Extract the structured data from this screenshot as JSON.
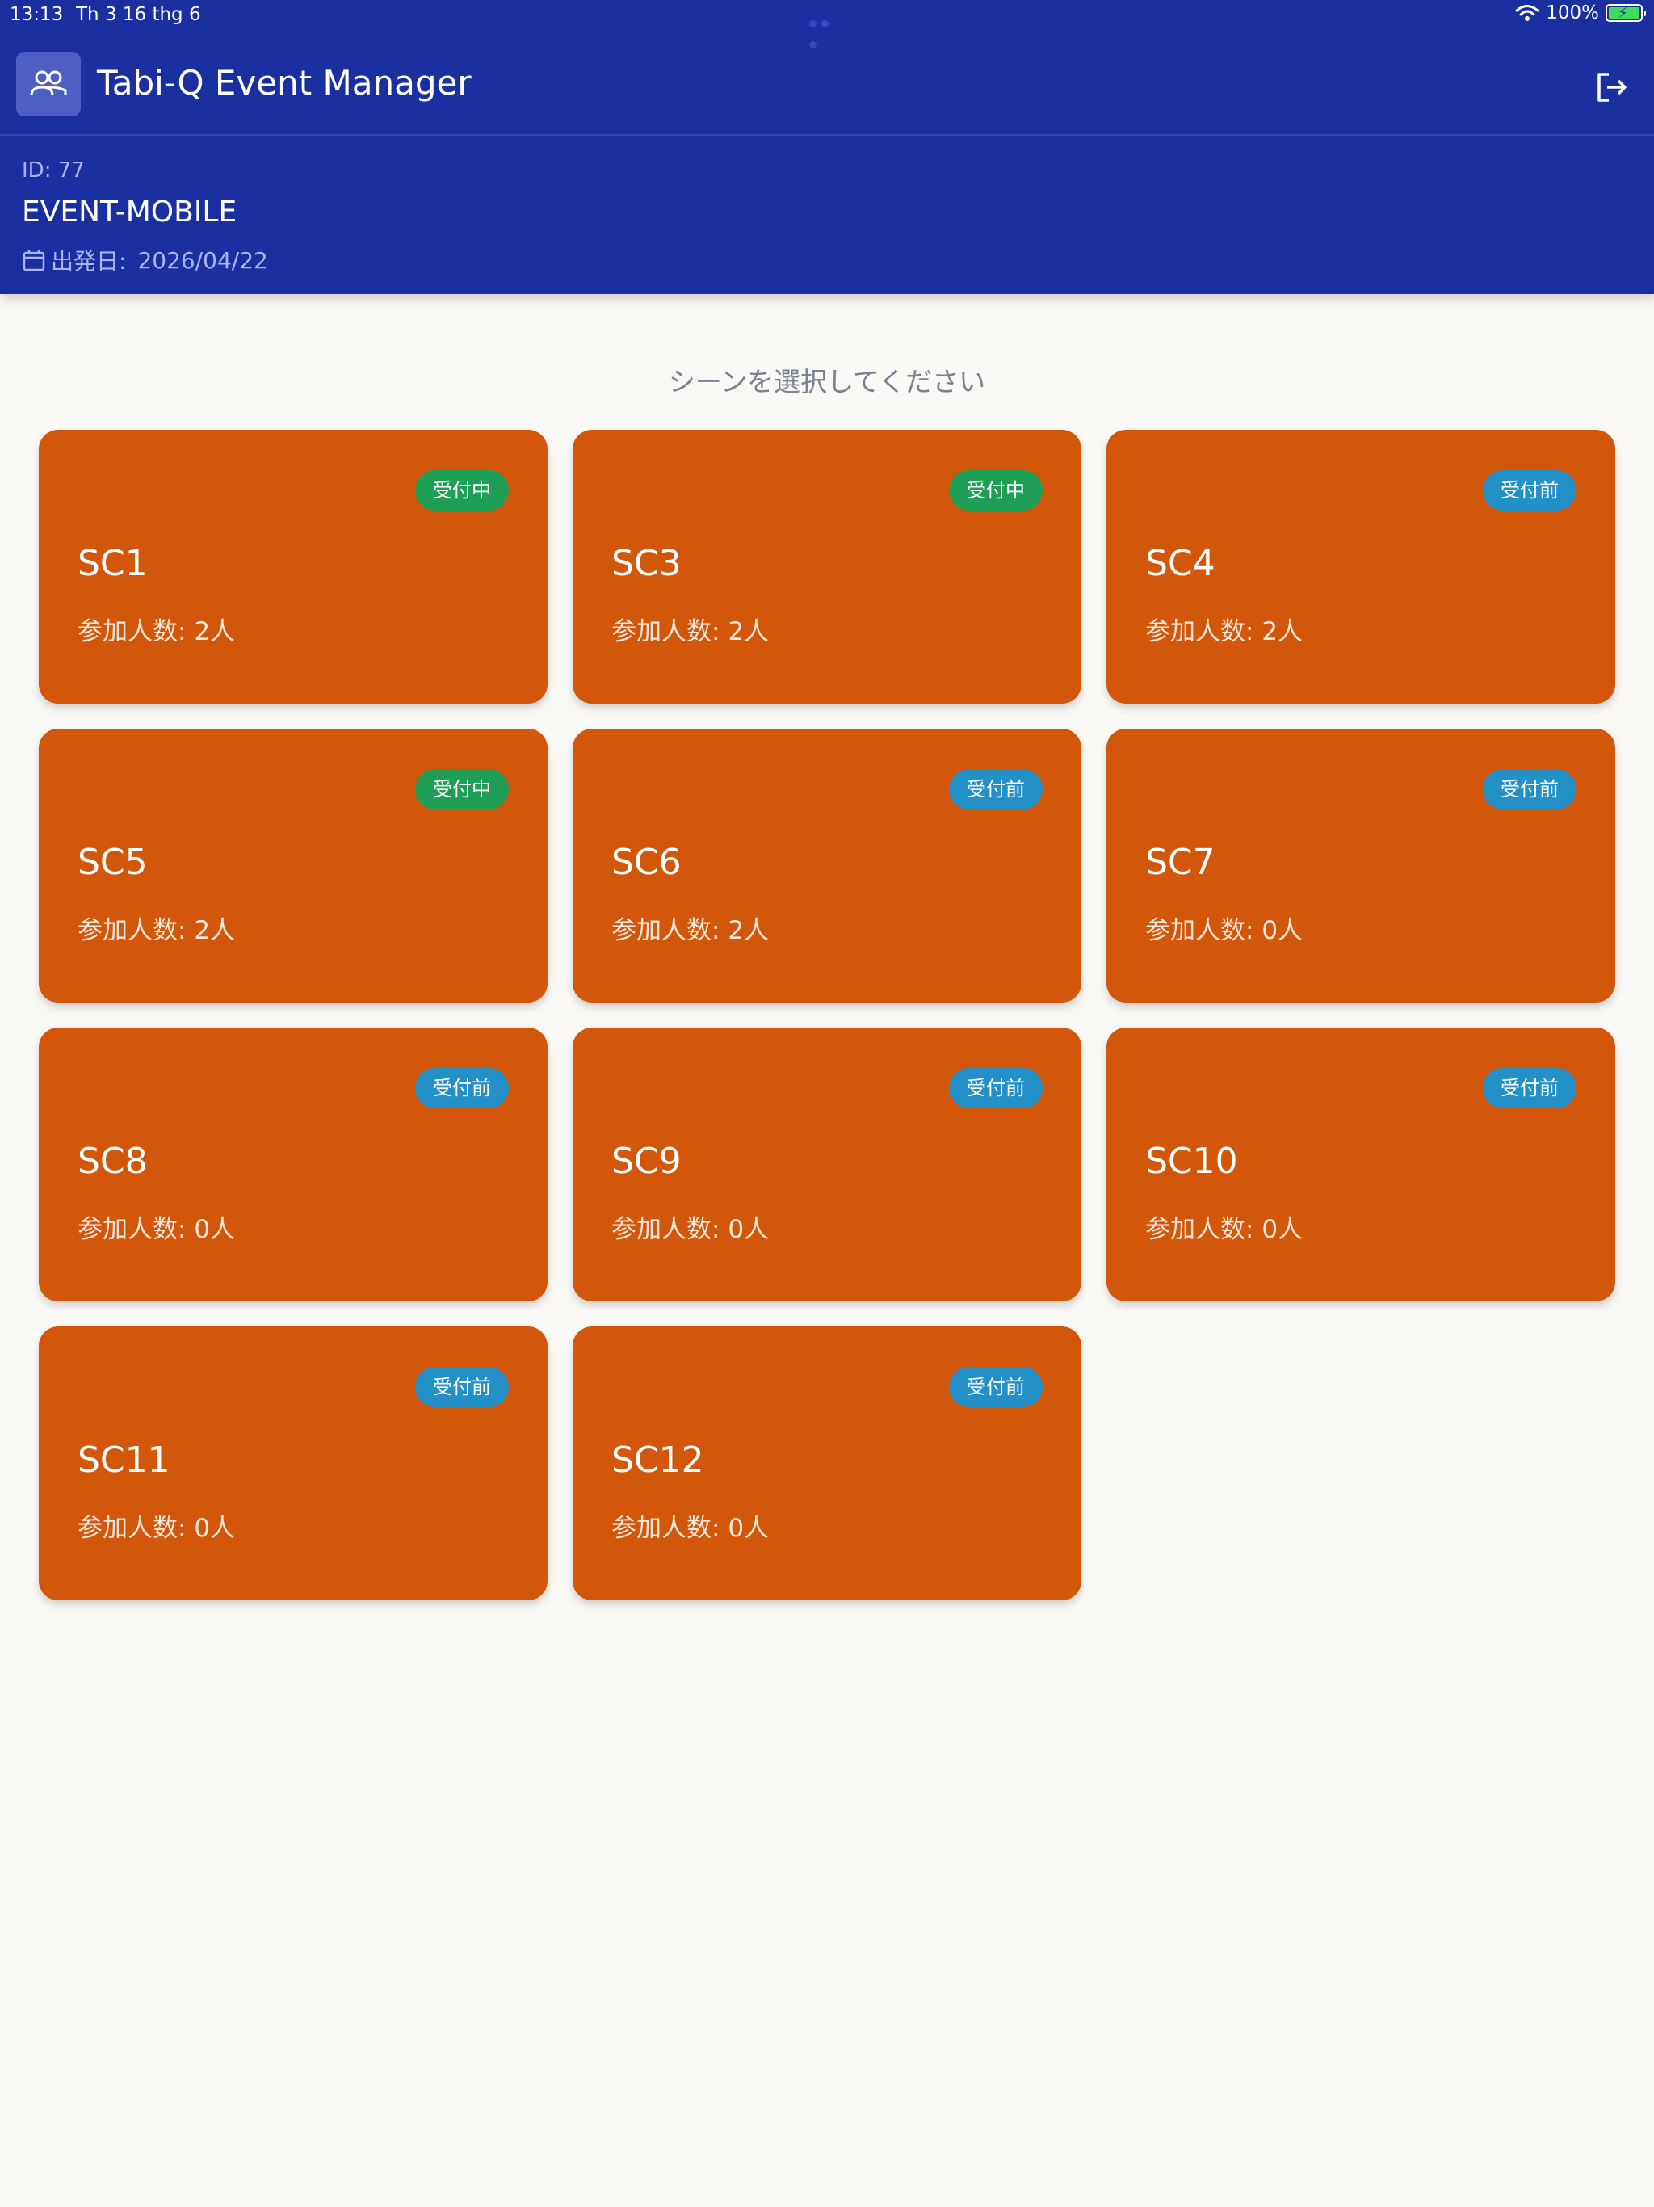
{
  "status_bar": {
    "time": "13:13",
    "date": "Th 3 16 thg 6",
    "battery": "100%"
  },
  "app": {
    "title": "Tabi-Q Event Manager",
    "icon": "users-icon",
    "logout_icon": "logout-icon"
  },
  "event": {
    "id_label": "ID: 77",
    "name": "EVENT-MOBILE",
    "date_label": "出発日:",
    "date": "2026/04/22"
  },
  "prompt": "シーンを選択してください",
  "scene_count_label": "参加人数:",
  "scenes": [
    {
      "name": "SC1",
      "status": "受付中",
      "count": "2人"
    },
    {
      "name": "SC3",
      "status": "受付中",
      "count": "2人"
    },
    {
      "name": "SC4",
      "status": "受付前",
      "count": "2人"
    },
    {
      "name": "SC5",
      "status": "受付中",
      "count": "2人"
    },
    {
      "name": "SC6",
      "status": "受付前",
      "count": "2人"
    },
    {
      "name": "SC7",
      "status": "受付前",
      "count": "0人"
    },
    {
      "name": "SC8",
      "status": "受付前",
      "count": "0人"
    },
    {
      "name": "SC9",
      "status": "受付前",
      "count": "0人"
    },
    {
      "name": "SC10",
      "status": "受付前",
      "count": "0人"
    },
    {
      "name": "SC11",
      "status": "受付前",
      "count": "0人"
    },
    {
      "name": "SC12",
      "status": "受付前",
      "count": "0人"
    }
  ],
  "colors": {
    "header": "#1a2fa0",
    "card": "#d2570b",
    "status_open": "#1f9e55",
    "status_before": "#2391c7",
    "background": "#faf9f6"
  }
}
